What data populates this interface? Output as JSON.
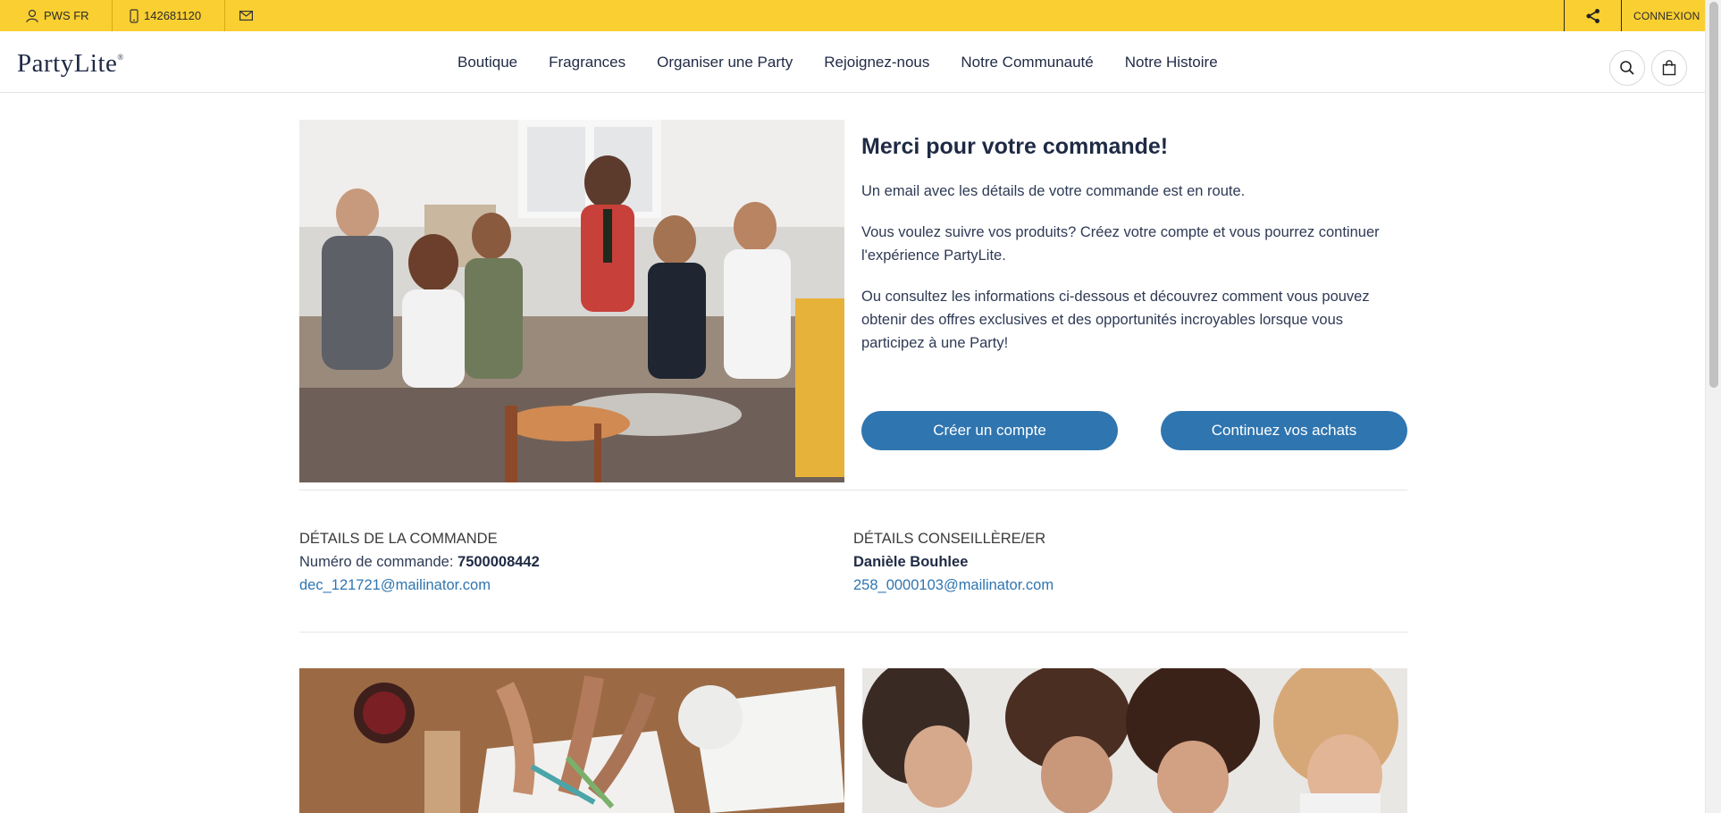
{
  "topbar": {
    "user_label": "PWS FR",
    "phone_label": "142681120",
    "login_label": "CONNEXION"
  },
  "header": {
    "logo_text": "PartyLite",
    "nav": [
      "Boutique",
      "Fragrances",
      "Organiser une Party",
      "Rejoignez-nous",
      "Notre Communauté",
      "Notre Histoire"
    ]
  },
  "hero": {
    "title": "Merci pour votre commande!",
    "p1": "Un email avec les détails de votre commande est en route.",
    "p2": "Vous voulez suivre vos produits? Créez votre compte et vous pourrez continuer l'expérience PartyLite.",
    "p3": "Ou consultez les informations ci-dessous et découvrez comment vous pouvez obtenir des offres exclusives et des opportunités incroyables lorsque vous participez à une Party!",
    "create_account_label": "Créer un compte",
    "continue_label": "Continuez vos achats"
  },
  "order": {
    "heading": "DÉTAILS DE LA COMMANDE",
    "number_label": "Numéro de commande:",
    "number": "7500008442",
    "email": "dec_121721@mailinator.com"
  },
  "consultant": {
    "heading": "DÉTAILS CONSEILLÈRE/ER",
    "name": "Danièle Bouhlee",
    "email": "258_0000103@mailinator.com"
  },
  "colors": {
    "topbar": "#f9cf31",
    "primary_button": "#2f75b0",
    "text_dark": "#1f2a44",
    "link": "#2f75b0"
  }
}
